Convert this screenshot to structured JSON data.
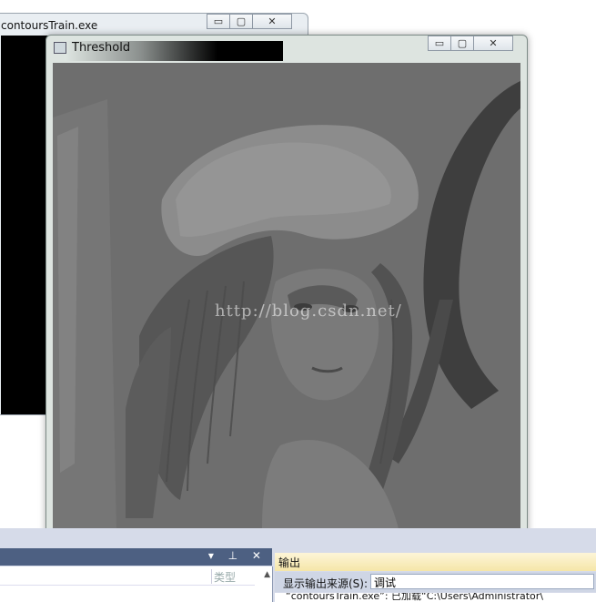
{
  "console_window": {
    "title": "contoursTrain.exe",
    "buttons": {
      "minimize": "▭",
      "maximize": "▢",
      "close": "✕"
    }
  },
  "threshold_window": {
    "title": "Threshold",
    "buttons": {
      "minimize": "▭",
      "maximize": "▢",
      "close": "✕"
    },
    "watermark": "http://blog.csdn.net/"
  },
  "ide": {
    "left_panel": {
      "controls": "▾ ⊥ ✕",
      "column_type": "类型"
    },
    "output_panel": {
      "title": "输出",
      "source_label": "显示输出来源(S):",
      "source_value": "调试",
      "first_line": "“contoursTrain.exe”: 已加载“C:\\Users\\Administrator\\"
    }
  },
  "colors": {
    "canvas_gray": "#6e6e6e",
    "ide_head": "#4d6082",
    "output_head": "#f5e6a8"
  }
}
